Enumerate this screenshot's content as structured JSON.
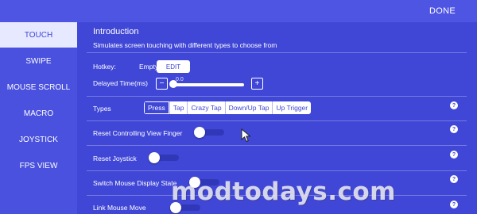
{
  "header": {
    "done_label": "DONE"
  },
  "sidebar": {
    "items": [
      {
        "label": "TOUCH",
        "active": true
      },
      {
        "label": "SWIPE",
        "active": false
      },
      {
        "label": "MOUSE SCROLL",
        "active": false
      },
      {
        "label": "MACRO",
        "active": false
      },
      {
        "label": "JOYSTICK",
        "active": false
      },
      {
        "label": "FPS VIEW",
        "active": false
      }
    ]
  },
  "main": {
    "title": "Introduction",
    "subtitle": "Simulates screen touching with different types to choose from",
    "hotkey": {
      "label": "Hotkey:",
      "value": "Empty",
      "edit_label": "EDIT"
    },
    "delay": {
      "label": "Delayed Time(ms)",
      "value": "0.0",
      "minus_label": "−",
      "plus_label": "+",
      "level": 0
    },
    "types": {
      "label": "Types",
      "options": [
        "Press",
        "Tap",
        "Crazy Tap",
        "Down/Up Tap",
        "Up Trigger"
      ],
      "selected": "Press"
    },
    "toggles": [
      {
        "label": "Reset Controlling View Finger",
        "on": false
      },
      {
        "label": "Reset Joystick",
        "on": false
      },
      {
        "label": "Switch Mouse Display State",
        "on": false
      },
      {
        "label": "Link Mouse Move",
        "on": false
      }
    ],
    "help_glyph": "?"
  },
  "watermark": "modtodays.com",
  "colors": {
    "background": "#4047d6",
    "sidebar_active_bg": "#e6e9ff",
    "accent_text": "#3f45d6"
  }
}
